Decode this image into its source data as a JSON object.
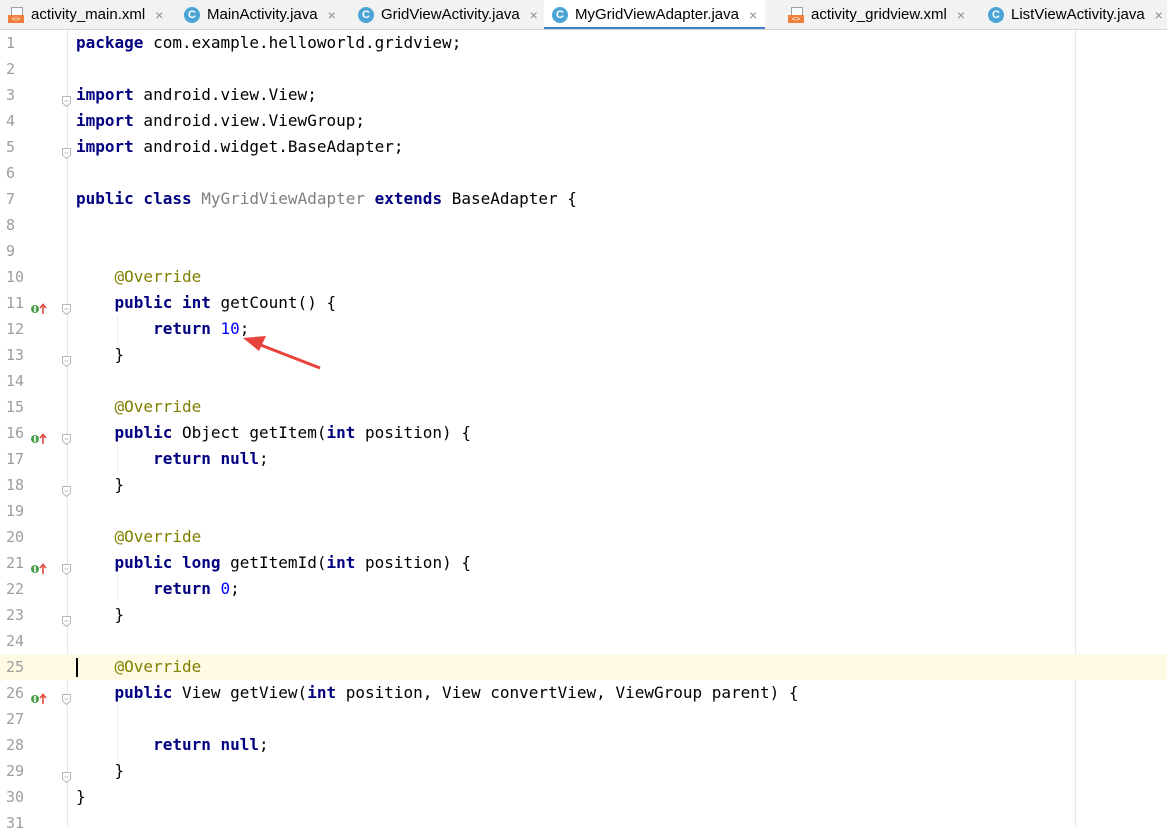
{
  "tabs": [
    {
      "label": "activity_main.xml",
      "icon": "xml-file-icon"
    },
    {
      "label": "MainActivity.java",
      "icon": "java-class-icon"
    },
    {
      "label": "GridViewActivity.java",
      "icon": "java-class-icon"
    },
    {
      "label": "MyGridViewAdapter.java",
      "icon": "java-class-icon",
      "active": true
    },
    {
      "label": "activity_gridview.xml",
      "icon": "xml-file-icon"
    },
    {
      "label": "ListViewActivity.java",
      "icon": "java-class-icon"
    }
  ],
  "close_glyph": "×",
  "class_icon_letter": "C",
  "xml_icon_text": "<>",
  "colors": {
    "keyword": "#000080",
    "annotation": "#808000",
    "number": "#0000ff",
    "unused_identifier": "#808080",
    "current_line": "#fffae3",
    "tab_active_underline": "#4083c9",
    "annotation_arrow": "#e8433a"
  },
  "editor": {
    "current_line": 25,
    "lines": [
      {
        "n": "1",
        "tokens": [
          {
            "t": "package",
            "c": "kw"
          },
          {
            "t": " com.example.helloworld.gridview;"
          }
        ]
      },
      {
        "n": "2",
        "tokens": []
      },
      {
        "n": "3",
        "tokens": [
          {
            "t": "import",
            "c": "kw"
          },
          {
            "t": " android.view.View;"
          }
        ],
        "fold": true
      },
      {
        "n": "4",
        "tokens": [
          {
            "t": "import",
            "c": "kw"
          },
          {
            "t": " android.view.ViewGroup;"
          }
        ]
      },
      {
        "n": "5",
        "tokens": [
          {
            "t": "import",
            "c": "kw"
          },
          {
            "t": " android.widget.BaseAdapter;"
          }
        ],
        "fold": true
      },
      {
        "n": "6",
        "tokens": []
      },
      {
        "n": "7",
        "tokens": [
          {
            "t": "public class",
            "c": "kw"
          },
          {
            "t": " "
          },
          {
            "t": "MyGridViewAdapter",
            "c": "unused"
          },
          {
            "t": " "
          },
          {
            "t": "extends",
            "c": "kw"
          },
          {
            "t": " BaseAdapter {"
          }
        ]
      },
      {
        "n": "8",
        "tokens": []
      },
      {
        "n": "9",
        "tokens": []
      },
      {
        "n": "10",
        "tokens": [
          {
            "t": "    "
          },
          {
            "t": "@Override",
            "c": "ann"
          }
        ]
      },
      {
        "n": "11",
        "tokens": [
          {
            "t": "    "
          },
          {
            "t": "public int",
            "c": "kw"
          },
          {
            "t": " getCount() {"
          }
        ],
        "impl": true,
        "fold": true
      },
      {
        "n": "12",
        "tokens": [
          {
            "t": "        "
          },
          {
            "t": "return",
            "c": "kw"
          },
          {
            "t": " "
          },
          {
            "t": "10",
            "c": "num"
          },
          {
            "t": ";"
          }
        ]
      },
      {
        "n": "13",
        "tokens": [
          {
            "t": "    }"
          }
        ],
        "fold": true
      },
      {
        "n": "14",
        "tokens": []
      },
      {
        "n": "15",
        "tokens": [
          {
            "t": "    "
          },
          {
            "t": "@Override",
            "c": "ann"
          }
        ]
      },
      {
        "n": "16",
        "tokens": [
          {
            "t": "    "
          },
          {
            "t": "public",
            "c": "kw"
          },
          {
            "t": " Object getItem("
          },
          {
            "t": "int",
            "c": "kw"
          },
          {
            "t": " position) {"
          }
        ],
        "impl": true,
        "fold": true
      },
      {
        "n": "17",
        "tokens": [
          {
            "t": "        "
          },
          {
            "t": "return null",
            "c": "kw"
          },
          {
            "t": ";"
          }
        ]
      },
      {
        "n": "18",
        "tokens": [
          {
            "t": "    }"
          }
        ],
        "fold": true
      },
      {
        "n": "19",
        "tokens": []
      },
      {
        "n": "20",
        "tokens": [
          {
            "t": "    "
          },
          {
            "t": "@Override",
            "c": "ann"
          }
        ]
      },
      {
        "n": "21",
        "tokens": [
          {
            "t": "    "
          },
          {
            "t": "public long",
            "c": "kw"
          },
          {
            "t": " getItemId("
          },
          {
            "t": "int",
            "c": "kw"
          },
          {
            "t": " position) {"
          }
        ],
        "impl": true,
        "fold": true
      },
      {
        "n": "22",
        "tokens": [
          {
            "t": "        "
          },
          {
            "t": "return",
            "c": "kw"
          },
          {
            "t": " "
          },
          {
            "t": "0",
            "c": "num"
          },
          {
            "t": ";"
          }
        ]
      },
      {
        "n": "23",
        "tokens": [
          {
            "t": "    }"
          }
        ],
        "fold": true
      },
      {
        "n": "24",
        "tokens": []
      },
      {
        "n": "25",
        "tokens": [
          {
            "t": "    "
          },
          {
            "t": "@Override",
            "c": "ann"
          }
        ]
      },
      {
        "n": "26",
        "tokens": [
          {
            "t": "    "
          },
          {
            "t": "public",
            "c": "kw"
          },
          {
            "t": " View getView("
          },
          {
            "t": "int",
            "c": "kw"
          },
          {
            "t": " position, View convertView, ViewGroup parent) {"
          }
        ],
        "impl": true,
        "fold": true
      },
      {
        "n": "27",
        "tokens": []
      },
      {
        "n": "28",
        "tokens": [
          {
            "t": "        "
          },
          {
            "t": "return null",
            "c": "kw"
          },
          {
            "t": ";"
          }
        ]
      },
      {
        "n": "29",
        "tokens": [
          {
            "t": "    }"
          }
        ],
        "fold": true
      },
      {
        "n": "30",
        "tokens": [
          {
            "t": "}"
          }
        ]
      },
      {
        "n": "31",
        "tokens": []
      }
    ]
  }
}
